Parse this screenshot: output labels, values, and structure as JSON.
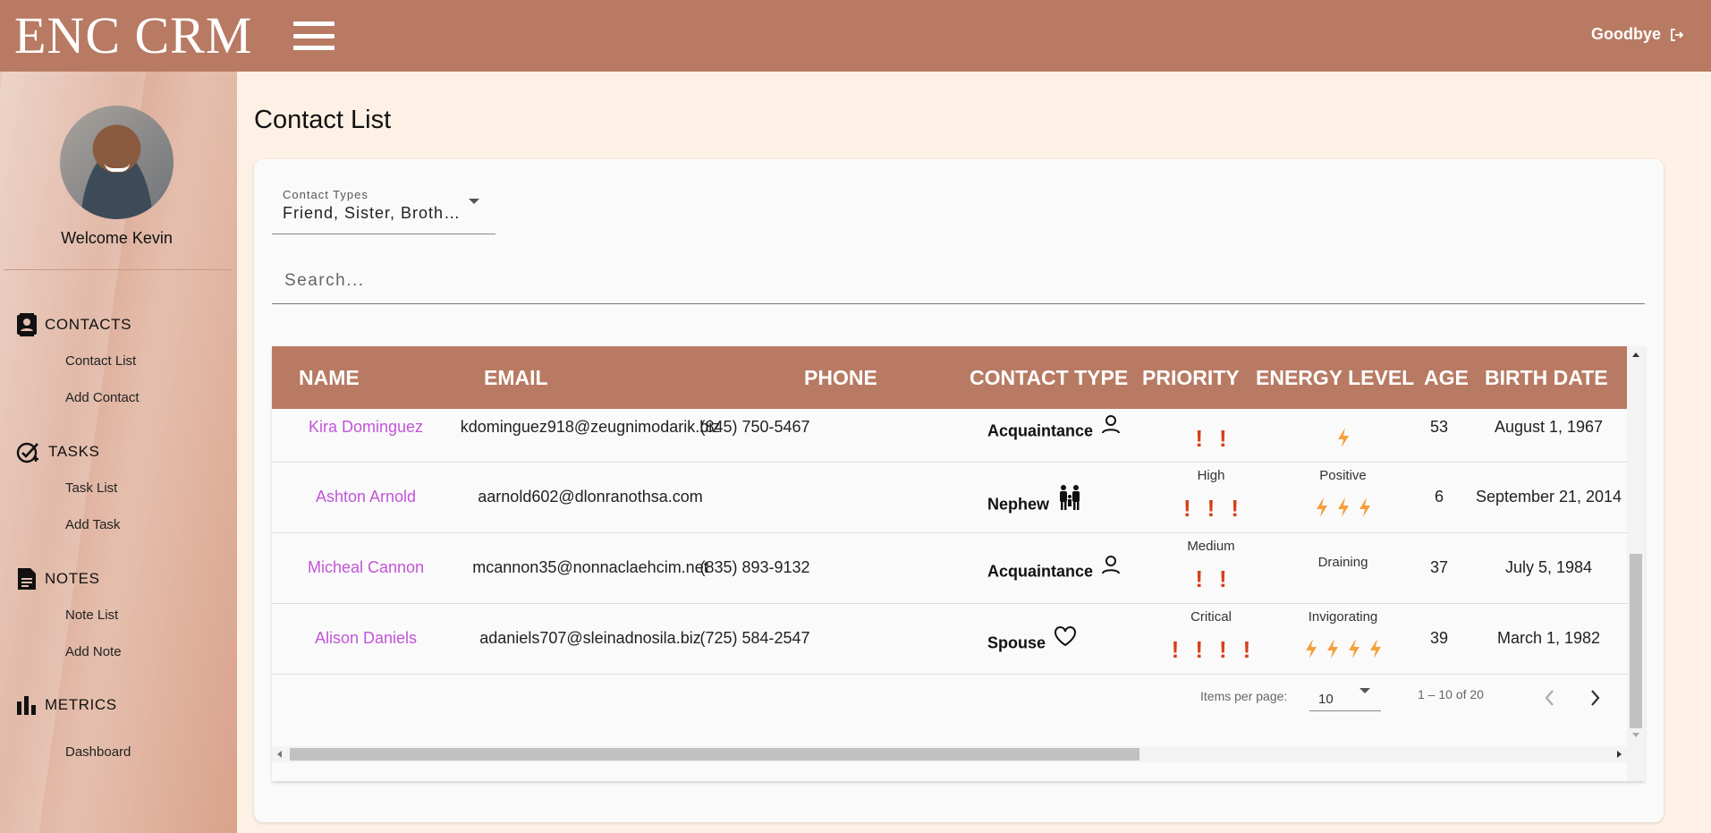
{
  "header": {
    "logo": "ENC CRM",
    "logout_label": "Goodbye"
  },
  "sidebar": {
    "welcome": "Welcome Kevin",
    "sections": [
      {
        "title": "CONTACTS",
        "items": [
          "Contact List",
          "Add Contact"
        ]
      },
      {
        "title": "TASKS",
        "items": [
          "Task List",
          "Add Task"
        ]
      },
      {
        "title": "NOTES",
        "items": [
          "Note List",
          "Add Note"
        ]
      },
      {
        "title": "METRICS",
        "items": [
          "Dashboard"
        ]
      }
    ]
  },
  "page": {
    "title": "Contact List"
  },
  "filter": {
    "label": "Contact Types",
    "value": "Friend, Sister, Broth…"
  },
  "search": {
    "placeholder": "Search..."
  },
  "table": {
    "columns": [
      "NAME",
      "EMAIL",
      "PHONE",
      "CONTACT TYPE",
      "PRIORITY",
      "ENERGY LEVEL",
      "AGE",
      "BIRTH DATE"
    ],
    "rows": [
      {
        "name": "Kira Dominguez",
        "email": "kdominguez918@zeugnimodarik.biz",
        "phone": "(845) 750-5467",
        "contact_type": "Acquaintance",
        "type_icon": "person-icon",
        "priority_label": "",
        "priority": 2,
        "energy_label": "",
        "energy": 1,
        "age": "53",
        "birth_date": "August 1, 1967"
      },
      {
        "name": "Ashton Arnold",
        "email": "aarnold602@dlonranothsa.com",
        "phone": "",
        "contact_type": "Nephew",
        "type_icon": "family-icon",
        "priority_label": "High",
        "priority": 3,
        "energy_label": "Positive",
        "energy": 3,
        "age": "6",
        "birth_date": "September 21, 2014"
      },
      {
        "name": "Micheal Cannon",
        "email": "mcannon35@nonnaclaehcim.net",
        "phone": "(835) 893-9132",
        "contact_type": "Acquaintance",
        "type_icon": "person-icon",
        "priority_label": "Medium",
        "priority": 2,
        "energy_label": "Draining",
        "energy": 0,
        "age": "37",
        "birth_date": "July 5, 1984"
      },
      {
        "name": "Alison Daniels",
        "email": "adaniels707@sleinadnosila.biz",
        "phone": "(725) 584-2547",
        "contact_type": "Spouse",
        "type_icon": "heart-icon",
        "priority_label": "Critical",
        "priority": 4,
        "energy_label": "Invigorating",
        "energy": 4,
        "age": "39",
        "birth_date": "March 1, 1982"
      }
    ]
  },
  "pagination": {
    "items_per_page_label": "Items per page:",
    "items_per_page": "10",
    "range": "1 – 10 of 20"
  },
  "colors": {
    "header": "#b87a63",
    "link": "#c255d8",
    "priority": "#d6401a",
    "energy": "#f5a03c"
  }
}
